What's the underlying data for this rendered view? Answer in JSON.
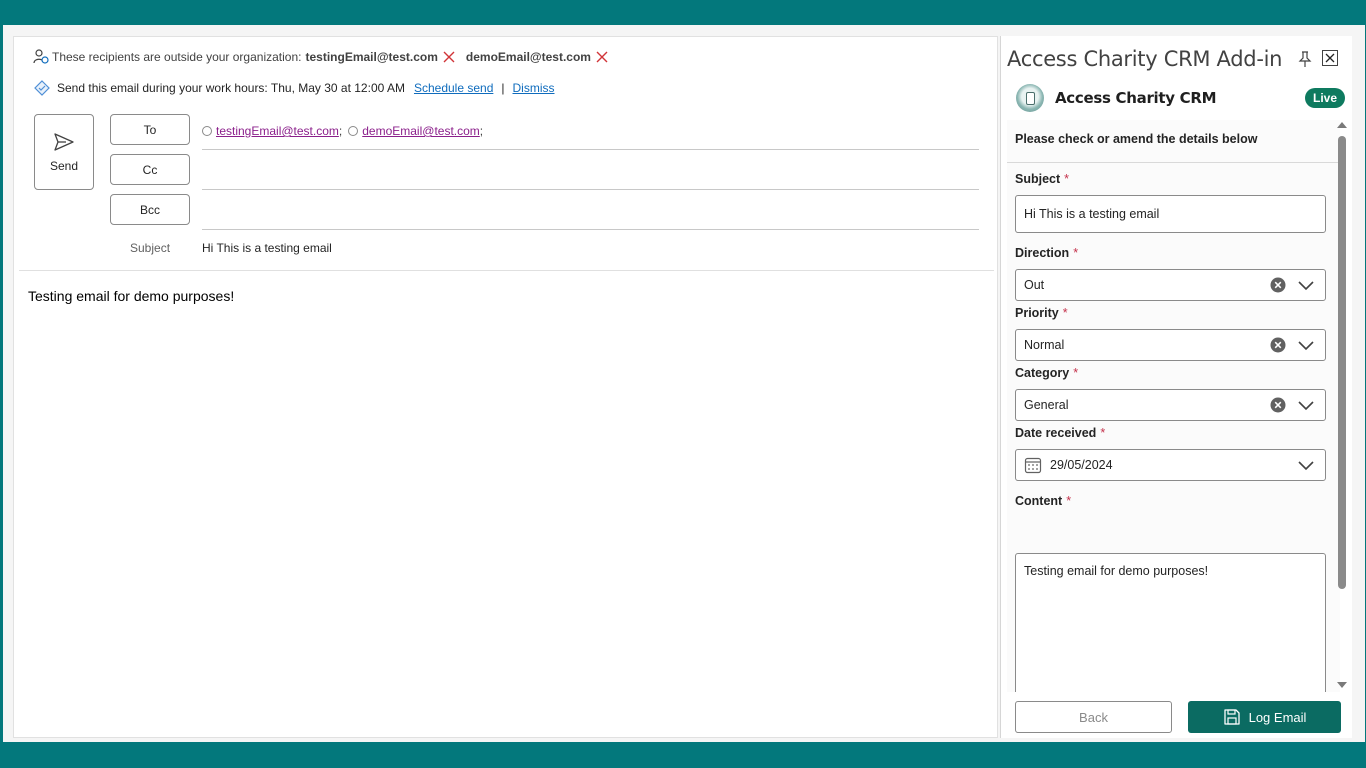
{
  "compose": {
    "external_warning": {
      "text": "These recipients are outside your organization:",
      "recipients": [
        "testingEmail@test.com",
        "demoEmail@test.com"
      ]
    },
    "work_hours": {
      "text": "Send this email during your work hours: Thu, May 30 at 12:00 AM",
      "schedule_link": "Schedule send",
      "separator": "|",
      "dismiss_link": "Dismiss"
    },
    "send_label": "Send",
    "to_label": "To",
    "cc_label": "Cc",
    "bcc_label": "Bcc",
    "to_recipients": [
      "testingEmail@test.com",
      "demoEmail@test.com"
    ],
    "recipient_separator": ";",
    "subject_label": "Subject",
    "subject_value": "Hi This is a testing email",
    "body": "Testing email for demo purposes!"
  },
  "addin": {
    "title": "Access Charity CRM Add-in",
    "brand_name": "Access Charity CRM",
    "status_badge": "Live",
    "form": {
      "heading": "Please check or amend the details below",
      "required_marker": "*",
      "subject": {
        "label": "Subject",
        "value": "Hi This is a testing email"
      },
      "direction": {
        "label": "Direction",
        "value": "Out"
      },
      "priority": {
        "label": "Priority",
        "value": "Normal"
      },
      "category": {
        "label": "Category",
        "value": "General"
      },
      "date_received": {
        "label": "Date received",
        "value": "29/05/2024"
      },
      "content": {
        "label": "Content",
        "value": "Testing email for demo purposes!"
      }
    },
    "back_label": "Back",
    "log_label": "Log Email"
  },
  "colors": {
    "app_frame": "#03787c",
    "link": "#0f6cbd",
    "recipient_link": "#8b1f8b",
    "remove_x": "#d13438",
    "live_badge": "#0e7a5f",
    "primary_button": "#0b6b62",
    "required": "#c4314b"
  }
}
